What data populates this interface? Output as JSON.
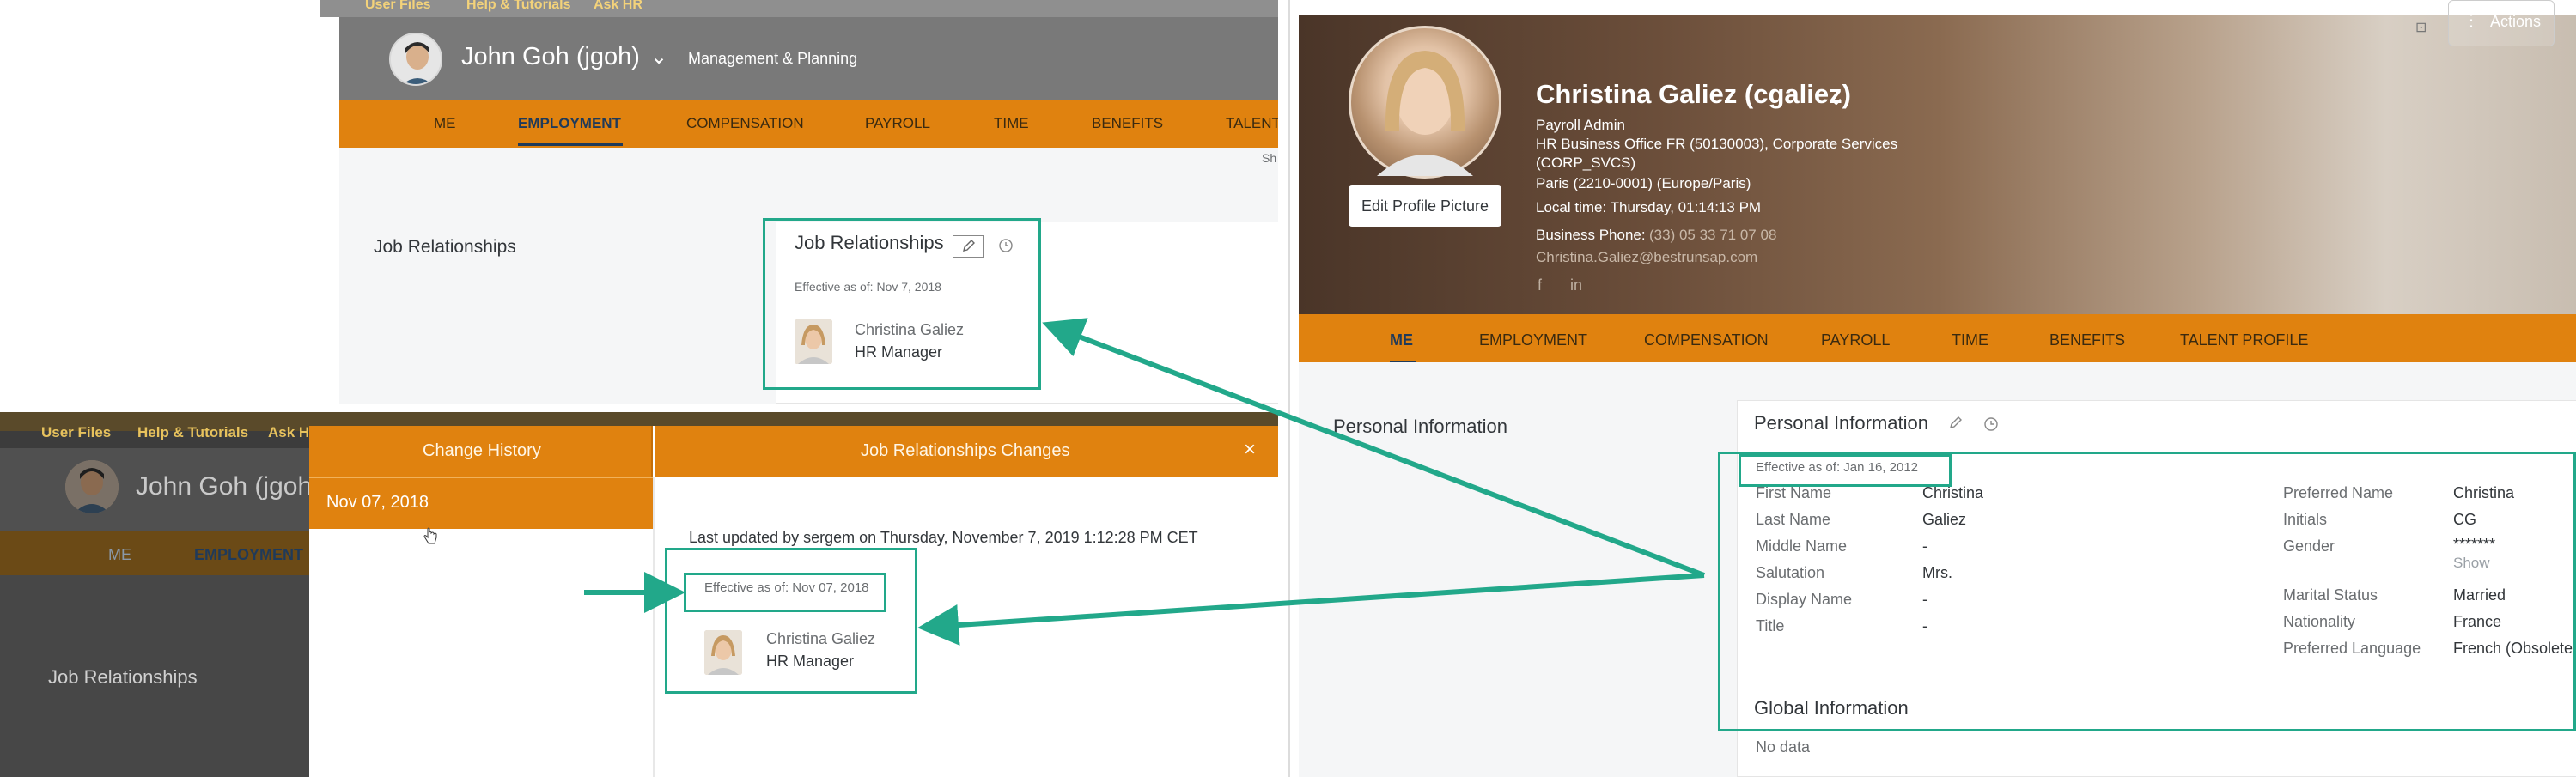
{
  "panel_a": {
    "util_items": [
      "User Files",
      "Help & Tutorials",
      "Ask HR"
    ],
    "employee_name": "John Goh (jgoh)",
    "department": "Management & Planning",
    "nav": [
      "ME",
      "EMPLOYMENT",
      "COMPENSATION",
      "PAYROLL",
      "TIME",
      "BENEFITS",
      "TALENT"
    ],
    "active_nav": "EMPLOYMENT",
    "section_title": "Job Relationships",
    "card_title": "Job Relationships",
    "effective": "Effective as of: Nov 7, 2018",
    "person_name": "Christina Galiez",
    "person_role": "HR Manager",
    "cut_text": "Sh"
  },
  "panel_b": {
    "util_items": [
      "User Files",
      "Help & Tutorials",
      "Ask H"
    ],
    "employee_name": "John Goh (jgoh",
    "nav": [
      "ME",
      "EMPLOYMENT"
    ],
    "section_title": "Job Relationships",
    "dialog": {
      "left_header": "Change History",
      "right_header": "Job Relationships Changes",
      "close_label": "×",
      "selected_date": "Nov 07, 2018",
      "last_updated": "Last updated by sergem on Thursday, November 7, 2019 1:12:28 PM CET",
      "effective": "Effective as of: Nov 07, 2018",
      "person_name": "Christina Galiez",
      "person_role": "HR Manager"
    }
  },
  "panel_c": {
    "edit_picture": "Edit Profile Picture",
    "actions": "Actions",
    "name": "Christina Galiez (cgaliez)",
    "header_lines": [
      "Payroll Admin",
      "HR Business Office FR (50130003), Corporate Services",
      "(CORP_SVCS)",
      "Paris (2210-0001) (Europe/Paris)",
      "Local time: Thursday, 01:14:13 PM"
    ],
    "business_phone_label": "Business Phone:",
    "business_phone": "(33) 05 33 71 07 08",
    "email": "Christina.Galiez@bestrunsap.com",
    "social": [
      "f",
      "in"
    ],
    "nav": [
      "ME",
      "EMPLOYMENT",
      "COMPENSATION",
      "PAYROLL",
      "TIME",
      "BENEFITS",
      "TALENT PROFILE"
    ],
    "active_nav": "ME",
    "section_title": "Personal Information",
    "card_title": "Personal Information",
    "effective": "Effective as of: Jan 16, 2012",
    "fields_left": [
      {
        "label": "First Name",
        "value": "Christina"
      },
      {
        "label": "Last Name",
        "value": "Galiez"
      },
      {
        "label": "Middle Name",
        "value": "-"
      },
      {
        "label": "Salutation",
        "value": "Mrs."
      },
      {
        "label": "Display Name",
        "value": "-"
      },
      {
        "label": "Title",
        "value": "-"
      }
    ],
    "fields_right": [
      {
        "label": "Preferred Name",
        "value": "Christina"
      },
      {
        "label": "Initials",
        "value": "CG"
      },
      {
        "label": "Gender",
        "value": "*******"
      },
      {
        "label": "Marital Status",
        "value": "Married"
      },
      {
        "label": "Nationality",
        "value": "France"
      },
      {
        "label": "Preferred Language",
        "value": "French (Obsolete"
      }
    ],
    "show_label": "Show",
    "global_info_title": "Global Information",
    "no_data": "No data"
  },
  "colors": {
    "nav_orange": "#e0820f",
    "annotation_teal": "#22a88a",
    "active_nav_blue": "#1f3a5a"
  }
}
